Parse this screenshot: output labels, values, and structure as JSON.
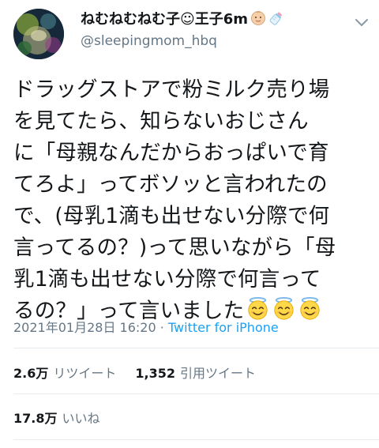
{
  "user": {
    "display_name": "ねむねむねむ子☺王子6m",
    "handle": "@sleepingmom_hbq"
  },
  "icons": {
    "avatar": "avatar-image",
    "baby": "baby-emoji-icon",
    "bottle": "baby-bottle-emoji-icon",
    "menu": "chevron-down-icon",
    "halo": "smiling-face-with-halo-emoji-icon"
  },
  "tweet": {
    "lines": [
      "ドラッグストアで粉ミルク売り場",
      "を見てたら、知らないおじさん",
      "に「母親なんだからおっぱいで育",
      "てろよ」ってボソッと言われたの",
      "で、(母乳1滴も出せない分際で何",
      "言ってるの？)って思いながら「母",
      "乳1滴も出せない分際で何言って",
      "るの？」って言いました"
    ]
  },
  "meta": {
    "timestamp": "2021年01月28日 16:20",
    "separator": " · ",
    "source": "Twitter for iPhone"
  },
  "stats": {
    "retweets_count": "2.6万",
    "retweets_label": "リツイート",
    "quotes_count": "1,352",
    "quotes_label": "引用ツイート",
    "likes_count": "17.8万",
    "likes_label": "いいね"
  },
  "colors": {
    "text": "#14171a",
    "secondary": "#657786",
    "link": "#1da1f2",
    "divider": "#e6ecf0"
  }
}
